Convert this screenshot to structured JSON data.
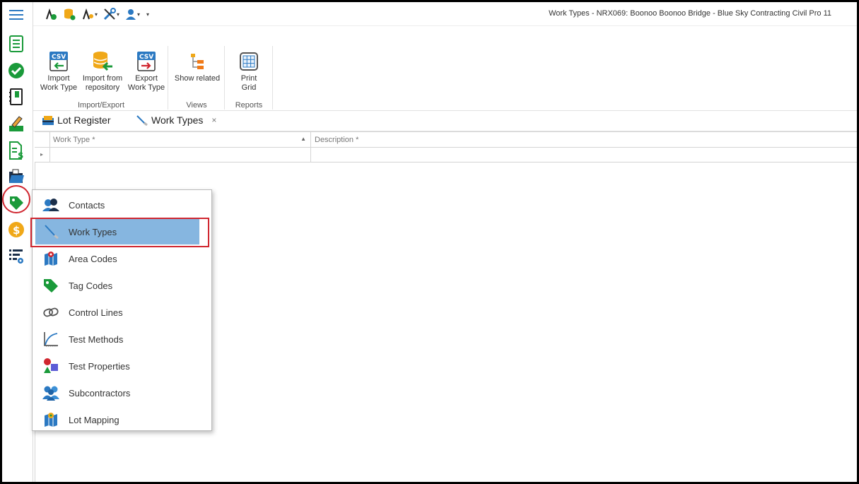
{
  "window": {
    "title": "Work Types - NRX069: Boonoo Boonoo Bridge  - Blue Sky Contracting Civil Pro 11"
  },
  "rail": {
    "items": [
      {
        "icon": "hamburger-menu-icon"
      },
      {
        "icon": "register-list-icon"
      },
      {
        "icon": "check-circle-icon"
      },
      {
        "icon": "notebook-icon"
      },
      {
        "icon": "sign-pen-icon"
      },
      {
        "icon": "cost-document-icon"
      },
      {
        "icon": "folder-open-icon"
      },
      {
        "icon": "tag-location-icon"
      },
      {
        "icon": "dollar-coin-icon"
      },
      {
        "icon": "settings-table-icon"
      }
    ]
  },
  "ribbon": {
    "groups": [
      {
        "label": "Import/Export",
        "buttons": [
          {
            "label": "Import\nWork Type",
            "icon": "csv-import-icon"
          },
          {
            "label": "Import from\nrepository",
            "icon": "database-import-icon"
          },
          {
            "label": "Export\nWork Type",
            "icon": "csv-export-icon"
          }
        ]
      },
      {
        "label": "Views",
        "buttons": [
          {
            "label": "Show related",
            "icon": "hierarchy-icon"
          }
        ]
      },
      {
        "label": "Reports",
        "buttons": [
          {
            "label": "Print\nGrid",
            "icon": "print-grid-icon"
          }
        ]
      }
    ]
  },
  "tabs": [
    {
      "label": "Lot Register",
      "icon": "lot-register-icon"
    },
    {
      "label": "Work Types",
      "icon": "work-types-icon",
      "close": "×"
    }
  ],
  "grid": {
    "columns": [
      "Work Type *",
      "Description *"
    ],
    "sort_indicator": "▲",
    "row_indicator": "▸"
  },
  "flyout": {
    "items": [
      {
        "label": "Contacts",
        "icon": "contacts-icon"
      },
      {
        "label": "Work Types",
        "icon": "work-types-icon",
        "selected": true
      },
      {
        "label": "Area Codes",
        "icon": "area-codes-icon"
      },
      {
        "label": "Tag Codes",
        "icon": "tag-codes-icon"
      },
      {
        "label": "Control Lines",
        "icon": "control-lines-icon"
      },
      {
        "label": "Test Methods",
        "icon": "test-methods-icon"
      },
      {
        "label": "Test Properties",
        "icon": "test-properties-icon"
      },
      {
        "label": "Subcontractors",
        "icon": "subcontractors-icon"
      },
      {
        "label": "Lot Mapping",
        "icon": "lot-mapping-icon"
      }
    ]
  },
  "colors": {
    "selection": "#86b6e0",
    "highlight_outline": "#d0262f",
    "brand_green": "#1a9a3a",
    "brand_blue": "#2b79c2"
  }
}
